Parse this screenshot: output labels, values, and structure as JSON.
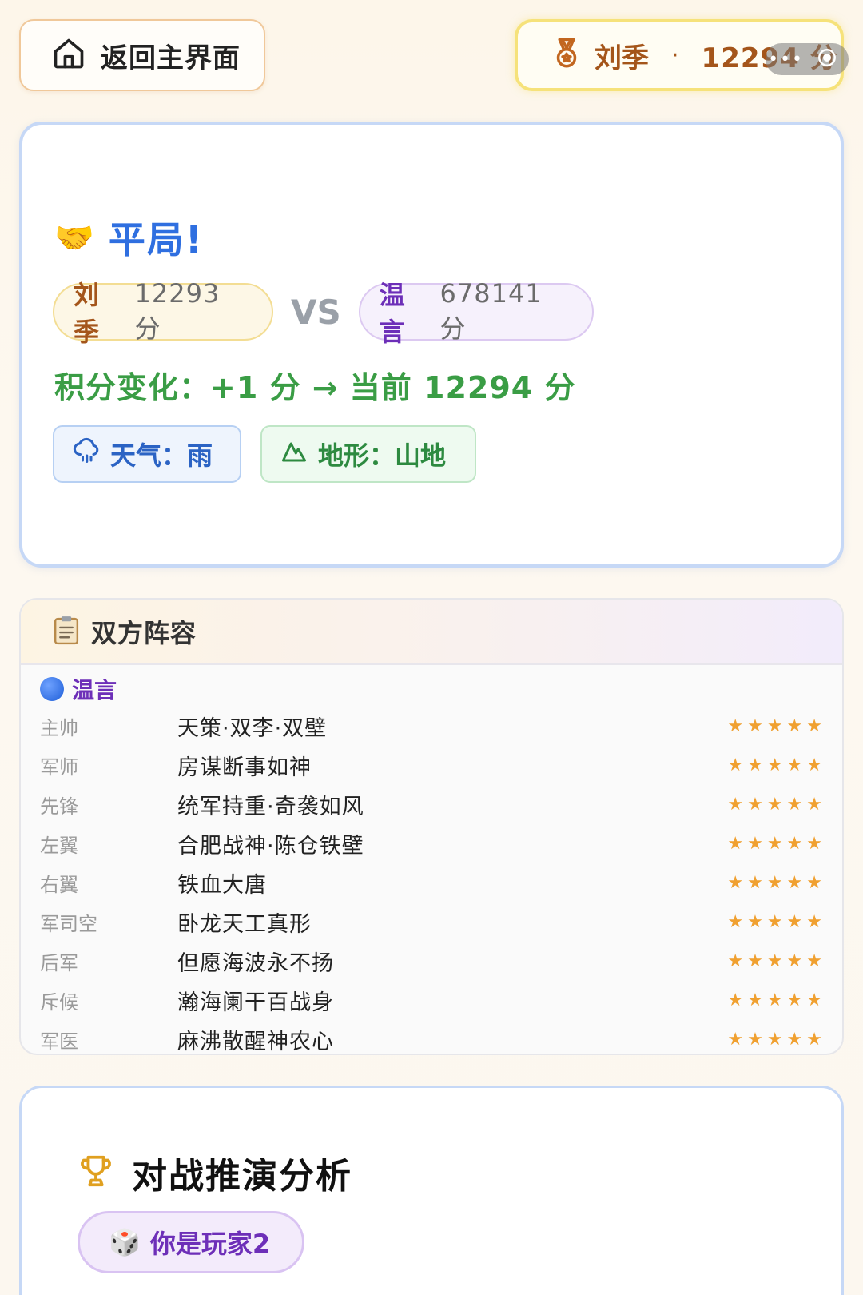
{
  "topbar": {
    "back_label": "返回主界面",
    "user_name": "刘季",
    "separator": "·",
    "user_score": "12294 分",
    "capsule_dots": "•••"
  },
  "result": {
    "emoji": "🤝",
    "title": "平局!",
    "player1": {
      "name": "刘季",
      "score": "12293 分"
    },
    "vs": "VS",
    "player2": {
      "name": "温言",
      "score": "678141 分"
    },
    "change": "积分变化：+1 分 → 当前 12294 分",
    "weather": "天气：雨",
    "terrain": "地形：山地"
  },
  "lineup": {
    "title": "双方阵容",
    "side_name": "温言",
    "rows": [
      {
        "role": "主帅",
        "card": "天策·双李·双壁",
        "stars": "★★★★★"
      },
      {
        "role": "军师",
        "card": "房谋断事如神",
        "stars": "★★★★★"
      },
      {
        "role": "先锋",
        "card": "统军持重·奇袭如风",
        "stars": "★★★★★"
      },
      {
        "role": "左翼",
        "card": "合肥战神·陈仓铁壁",
        "stars": "★★★★★"
      },
      {
        "role": "右翼",
        "card": "铁血大唐",
        "stars": "★★★★★"
      },
      {
        "role": "军司空",
        "card": "卧龙天工真形",
        "stars": "★★★★★"
      },
      {
        "role": "后军",
        "card": "但愿海波永不扬",
        "stars": "★★★★★"
      },
      {
        "role": "斥候",
        "card": "瀚海阑干百战身",
        "stars": "★★★★★"
      },
      {
        "role": "军医",
        "card": "麻沸散醒神农心",
        "stars": "★★★★★"
      }
    ]
  },
  "analysis": {
    "title": "对战推演分析",
    "you_emoji": "🎲",
    "you_label": "你是玩家2"
  },
  "colors": {
    "accent_blue": "#2f6fe0",
    "accent_green": "#3a9d45",
    "accent_purple": "#6d2fb8",
    "accent_brown": "#a4551a",
    "star": "#f0a030"
  },
  "icons": {
    "back": "home-icon",
    "score": "medal-icon",
    "weather": "rain-cloud-icon",
    "terrain": "mountain-icon",
    "lineup": "clipboard-icon",
    "analysis": "trophy-icon"
  }
}
